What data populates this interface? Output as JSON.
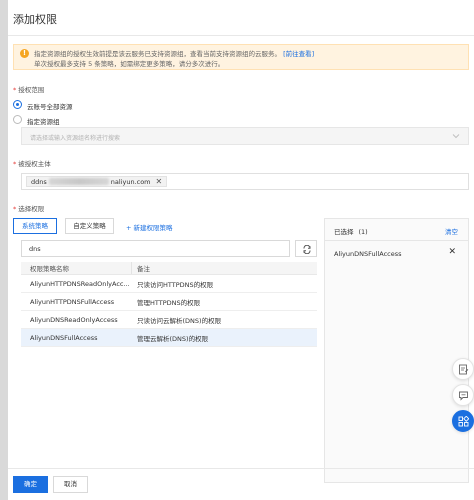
{
  "dialog": {
    "title": "添加权限"
  },
  "notice": {
    "line1": "指定资源组的授权生效前提是该云服务已支持资源组，查看当前支持资源组的云服务。",
    "link": "[前往查看]",
    "line2": "单次授权最多支持 5 条策略，如需绑定更多策略，请分多次进行。",
    "icon": "warning-icon",
    "color": "#fff3e0"
  },
  "scope": {
    "label": "授权范围",
    "options": [
      {
        "label": "云账号全部资源",
        "selected": true
      },
      {
        "label": "指定资源组",
        "selected": false
      }
    ],
    "resource_group_placeholder": "请选择或输入资源组名称进行搜索"
  },
  "principal": {
    "label": "被授权主体",
    "tag_prefix": "ddns",
    "tag_suffix": "naliyun.com"
  },
  "policy": {
    "label": "选择权限",
    "tabs": [
      {
        "label": "系统策略",
        "active": true
      },
      {
        "label": "自定义策略",
        "active": false
      }
    ],
    "new_policy": "新建权限策略",
    "search_value": "dns",
    "table": {
      "headers": [
        "权限策略名称",
        "备注"
      ],
      "rows": [
        {
          "name": "AliyunHTTPDNSReadOnlyAcc...",
          "note": "只读访问HTTPDNS的权限",
          "selected": false
        },
        {
          "name": "AliyunHTTPDNSFullAccess",
          "note": "管理HTTPDNS的权限",
          "selected": false
        },
        {
          "name": "AliyunDNSReadOnlyAccess",
          "note": "只读访问云解析(DNS)的权限",
          "selected": false
        },
        {
          "name": "AliyunDNSFullAccess",
          "note": "管理云解析(DNS)的权限",
          "selected": true
        }
      ]
    }
  },
  "selected_panel": {
    "title": "已选择",
    "count": "(1)",
    "clear": "清空",
    "items": [
      "AliyunDNSFullAccess"
    ]
  },
  "footer": {
    "ok": "确定",
    "cancel": "取消"
  },
  "colors": {
    "accent": "#1b6fe0",
    "required": "#e53935",
    "selected_row": "#eaf2fc"
  }
}
